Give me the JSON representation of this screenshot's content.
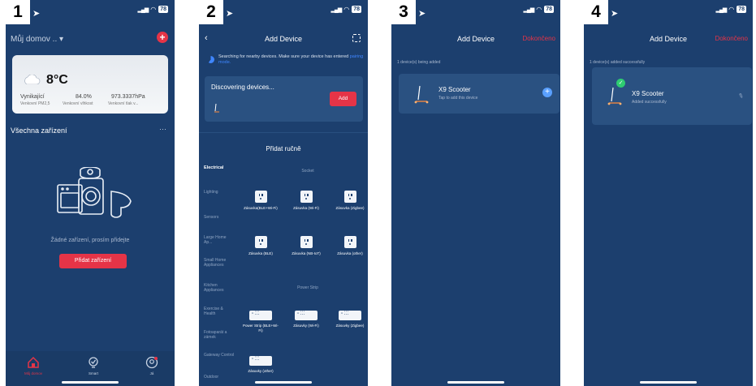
{
  "status": {
    "battery": "78"
  },
  "screens": [
    {
      "number": "1",
      "home_title": "Můj domov ..",
      "add_icon": "plus-icon",
      "weather": {
        "temp": "8°C",
        "air_quality": "Vynikající",
        "humidity": "84.0%",
        "pressure": "973.3337hPa",
        "air_quality_label": "Venkovní PM2,5",
        "humidity_label": "Venkovní vlhkost",
        "pressure_label": "Venkovní tlak v..."
      },
      "section_title": "Všechna zařízení",
      "empty_text": "Žádné zařízení, prosím přidejte",
      "add_button": "Přidat zařízení",
      "tabs": [
        "Můj domov",
        "Smart",
        "Já"
      ]
    },
    {
      "number": "2",
      "title": "Add Device",
      "search_text": "Searching for nearby devices. Make sure your device has entered",
      "search_link": "pairing mode.",
      "discovering": "Discovering devices...",
      "add_button": "Add",
      "manual_title": "Přidat ručně",
      "categories": [
        "Electrical",
        "Lighting",
        "Sensors",
        "Large Home Ap...",
        "Small Home Appliances",
        "Kitchen Appliances",
        "Exercise & Health",
        "Fotoaparát a zámek",
        "Gateway Control",
        "Outdoor"
      ],
      "groups": {
        "socket": "Socket",
        "power_strip": "Power Strip"
      },
      "socket_items": [
        "Zásuvka(BLE+Wi-Fi)",
        "Zásuvka (Wi-Fi)",
        "Zásuvka (Zigbee)",
        "Zásuvka (BLE)",
        "Zásuvka (NB-IoT)",
        "Zásuvka (other)"
      ],
      "strip_items": [
        "Power Strip (BLE+Wi-Fi)",
        "Zásuvky (Wi-Fi)",
        "Zásuvky (Zigbee)",
        "Zásuvky (other)"
      ]
    },
    {
      "number": "3",
      "title": "Add Device",
      "done": "Dokončeno",
      "count_line": "1 device(s) being added",
      "device_name": "X9 Scooter",
      "device_sub": "Tap to add this device"
    },
    {
      "number": "4",
      "title": "Add Device",
      "done": "Dokončeno",
      "count_line": "1 device(s) added successfully",
      "device_name": "X9 Scooter",
      "device_sub": "Added successfully"
    }
  ]
}
